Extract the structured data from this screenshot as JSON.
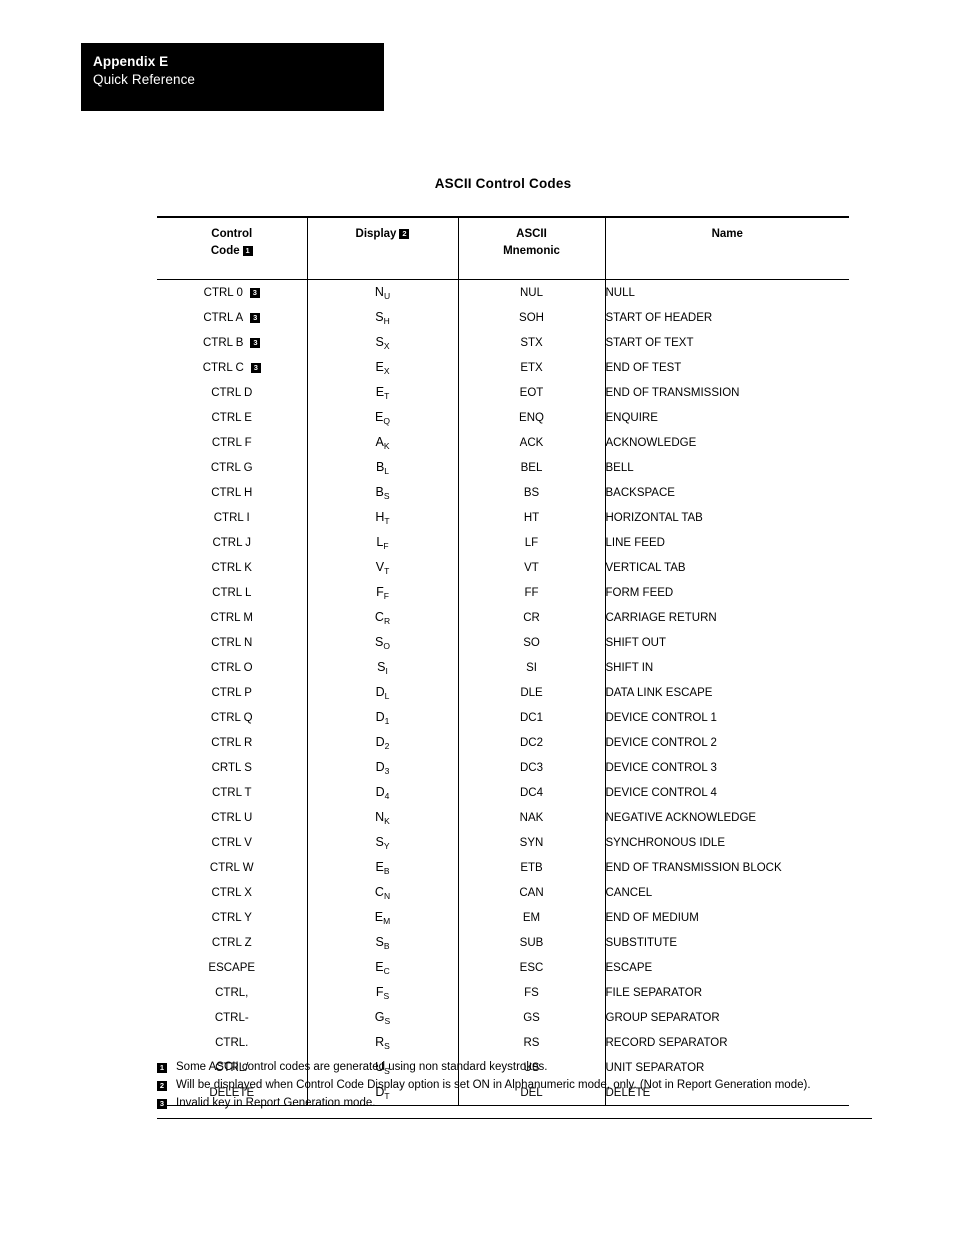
{
  "appendix_header": {
    "title": "Appendix E",
    "subtitle": "Quick Reference"
  },
  "page_title": "ASCII Control Codes",
  "table": {
    "headers": {
      "control_code_line1": "Control",
      "control_code_line2": "Code",
      "control_code_badge": "1",
      "display": "Display",
      "display_badge": "2",
      "ascii_line1": "ASCII",
      "ascii_line2": "Mnemonic",
      "name": "Name"
    },
    "rows": [
      {
        "code": "CTRL 0",
        "badge": "3",
        "display_base": "N",
        "display_sub": "U",
        "mnemonic": "NUL",
        "name": "NULL"
      },
      {
        "code": "CTRL A",
        "badge": "3",
        "display_base": "S",
        "display_sub": "H",
        "mnemonic": "SOH",
        "name": "START OF HEADER"
      },
      {
        "code": "CTRL B",
        "badge": "3",
        "display_base": "S",
        "display_sub": "X",
        "mnemonic": "STX",
        "name": "START OF TEXT"
      },
      {
        "code": "CTRL C",
        "badge": "3",
        "display_base": "E",
        "display_sub": "X",
        "mnemonic": "ETX",
        "name": "END OF TEST"
      },
      {
        "code": "CTRL D",
        "badge": "",
        "display_base": "E",
        "display_sub": "T",
        "mnemonic": "EOT",
        "name": "END OF TRANSMISSION"
      },
      {
        "code": "CTRL E",
        "badge": "",
        "display_base": "E",
        "display_sub": "Q",
        "mnemonic": "ENQ",
        "name": "ENQUIRE"
      },
      {
        "code": "CTRL F",
        "badge": "",
        "display_base": "A",
        "display_sub": "K",
        "mnemonic": "ACK",
        "name": "ACKNOWLEDGE"
      },
      {
        "code": "CTRL G",
        "badge": "",
        "display_base": "B",
        "display_sub": "L",
        "mnemonic": "BEL",
        "name": "BELL"
      },
      {
        "code": "CTRL H",
        "badge": "",
        "display_base": "B",
        "display_sub": "S",
        "mnemonic": "BS",
        "name": "BACKSPACE"
      },
      {
        "code": "CTRL I",
        "badge": "",
        "display_base": "H",
        "display_sub": "T",
        "mnemonic": "HT",
        "name": "HORIZONTAL TAB"
      },
      {
        "code": "CTRL J",
        "badge": "",
        "display_base": "L",
        "display_sub": "F",
        "mnemonic": "LF",
        "name": "LINE FEED"
      },
      {
        "code": "CTRL K",
        "badge": "",
        "display_base": "V",
        "display_sub": "T",
        "mnemonic": "VT",
        "name": "VERTICAL TAB"
      },
      {
        "code": "CTRL L",
        "badge": "",
        "display_base": "F",
        "display_sub": "F",
        "mnemonic": "FF",
        "name": "FORM FEED"
      },
      {
        "code": "CTRL M",
        "badge": "",
        "display_base": "C",
        "display_sub": "R",
        "mnemonic": "CR",
        "name": "CARRIAGE RETURN"
      },
      {
        "code": "CTRL N",
        "badge": "",
        "display_base": "S",
        "display_sub": "O",
        "mnemonic": "SO",
        "name": "SHIFT OUT"
      },
      {
        "code": "CTRL O",
        "badge": "",
        "display_base": "S",
        "display_sub": "I",
        "mnemonic": "SI",
        "name": "SHIFT IN"
      },
      {
        "code": "CTRL P",
        "badge": "",
        "display_base": "D",
        "display_sub": "L",
        "mnemonic": "DLE",
        "name": "DATA LINK ESCAPE"
      },
      {
        "code": "CTRL Q",
        "badge": "",
        "display_base": "D",
        "display_sub": "1",
        "mnemonic": "DC1",
        "name": "DEVICE CONTROL 1"
      },
      {
        "code": "CTRL R",
        "badge": "",
        "display_base": "D",
        "display_sub": "2",
        "mnemonic": "DC2",
        "name": "DEVICE CONTROL 2"
      },
      {
        "code": "CRTL S",
        "badge": "",
        "display_base": "D",
        "display_sub": "3",
        "mnemonic": "DC3",
        "name": "DEVICE CONTROL 3"
      },
      {
        "code": "CTRL T",
        "badge": "",
        "display_base": "D",
        "display_sub": "4",
        "mnemonic": "DC4",
        "name": "DEVICE CONTROL 4"
      },
      {
        "code": "CTRL U",
        "badge": "",
        "display_base": "N",
        "display_sub": "K",
        "mnemonic": "NAK",
        "name": "NEGATIVE ACKNOWLEDGE"
      },
      {
        "code": "CTRL V",
        "badge": "",
        "display_base": "S",
        "display_sub": "Y",
        "mnemonic": "SYN",
        "name": "SYNCHRONOUS IDLE"
      },
      {
        "code": "CTRL W",
        "badge": "",
        "display_base": "E",
        "display_sub": "B",
        "mnemonic": "ETB",
        "name": "END OF TRANSMISSION BLOCK"
      },
      {
        "code": "CTRL X",
        "badge": "",
        "display_base": "C",
        "display_sub": "N",
        "mnemonic": "CAN",
        "name": "CANCEL"
      },
      {
        "code": "CTRL Y",
        "badge": "",
        "display_base": "E",
        "display_sub": "M",
        "mnemonic": "EM",
        "name": "END OF MEDIUM"
      },
      {
        "code": "CTRL Z",
        "badge": "",
        "display_base": "S",
        "display_sub": "B",
        "mnemonic": "SUB",
        "name": "SUBSTITUTE"
      },
      {
        "code": "ESCAPE",
        "badge": "",
        "display_base": "E",
        "display_sub": "C",
        "mnemonic": "ESC",
        "name": "ESCAPE"
      },
      {
        "code": "CTRL,",
        "badge": "",
        "display_base": "F",
        "display_sub": "S",
        "mnemonic": "FS",
        "name": "FILE SEPARATOR"
      },
      {
        "code": "CTRL-",
        "badge": "",
        "display_base": "G",
        "display_sub": "S",
        "mnemonic": "GS",
        "name": "GROUP SEPARATOR"
      },
      {
        "code": "CTRL.",
        "badge": "",
        "display_base": "R",
        "display_sub": "S",
        "mnemonic": "RS",
        "name": "RECORD SEPARATOR"
      },
      {
        "code": "CTRL/",
        "badge": "",
        "display_base": "U",
        "display_sub": "S",
        "mnemonic": "US",
        "name": "UNIT SEPARATOR"
      },
      {
        "code": "DELETE",
        "badge": "",
        "display_base": "D",
        "display_sub": "T",
        "mnemonic": "DEL",
        "name": "DELETE"
      }
    ]
  },
  "footnotes": [
    {
      "badge": "1",
      "text": "Some ASCII control codes are generated using non standard keystrokes."
    },
    {
      "badge": "2",
      "text": "Will be displayed when Control Code Display option is set ON in Alphanumeric mode, only.  (Not in Report Generation mode)."
    },
    {
      "badge": "3",
      "text": "Invalid key in Report Generation mode."
    }
  ]
}
